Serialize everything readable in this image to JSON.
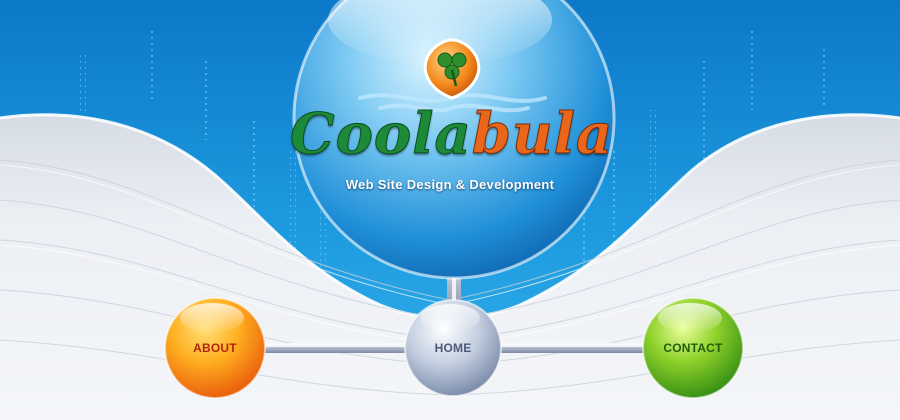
{
  "brand": {
    "title_main": "Coola",
    "title_accent": "bula",
    "tagline": "Web Site Design & Development"
  },
  "nav": [
    {
      "id": "about",
      "label": "ABOUT",
      "color": "#f07a0c"
    },
    {
      "id": "home",
      "label": "HOME",
      "color": "#8fa0bb"
    },
    {
      "id": "contact",
      "label": "CONTACT",
      "color": "#4aa51b"
    }
  ],
  "colors": {
    "sky_blue": "#1b8fd6",
    "panel_gray": "#e6eaf0",
    "logo_green": "#1d8a3a",
    "logo_orange": "#e9661b"
  },
  "icons": {
    "logo_emblem": "shamrock-icon"
  }
}
